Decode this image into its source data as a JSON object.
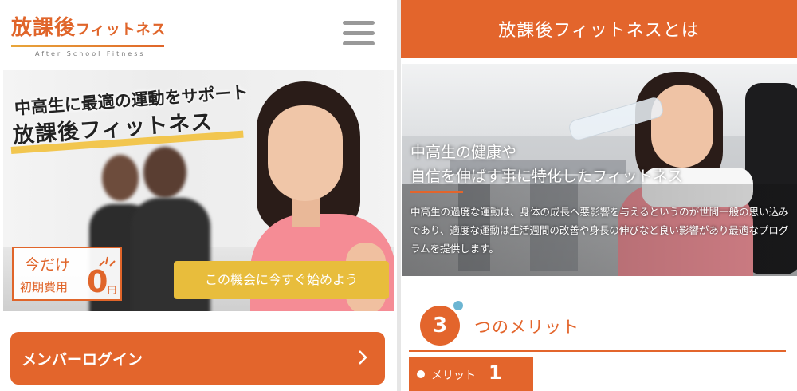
{
  "left_screen": {
    "logo": {
      "main": "放課後",
      "sub": "フィットネス",
      "tagline": "After School Fitness"
    },
    "hero": {
      "subtitle": "中高生に最適の運動をサポート",
      "title": "放課後フィットネス"
    },
    "promo": {
      "line1": "今だけ",
      "line2": "初期費用",
      "price": "0",
      "unit": "円"
    },
    "cta_label": "この機会に今すぐ始めよう",
    "login_label": "メンバーログイン"
  },
  "right_screen": {
    "header_title": "放課後フィットネスとは",
    "hero": {
      "heading_line1": "中高生の健康や",
      "heading_line2": "自信を伸ばす事に特化したフィットネス",
      "body": "中高生の過度な運動は、身体の成長へ悪影響を与えるというのが世間一般の思い込みであり、適度な運動は生活週間の改善や身長の伸びなど良い影響があり最適なプログラムを提供します。"
    },
    "merits": {
      "count": "3",
      "label": "つのメリット",
      "first_label": "メリット",
      "first_num": "1"
    }
  },
  "colors": {
    "accent": "#e3652c",
    "yellow": "#e8bd3c",
    "dot": "#6cb5d2"
  }
}
